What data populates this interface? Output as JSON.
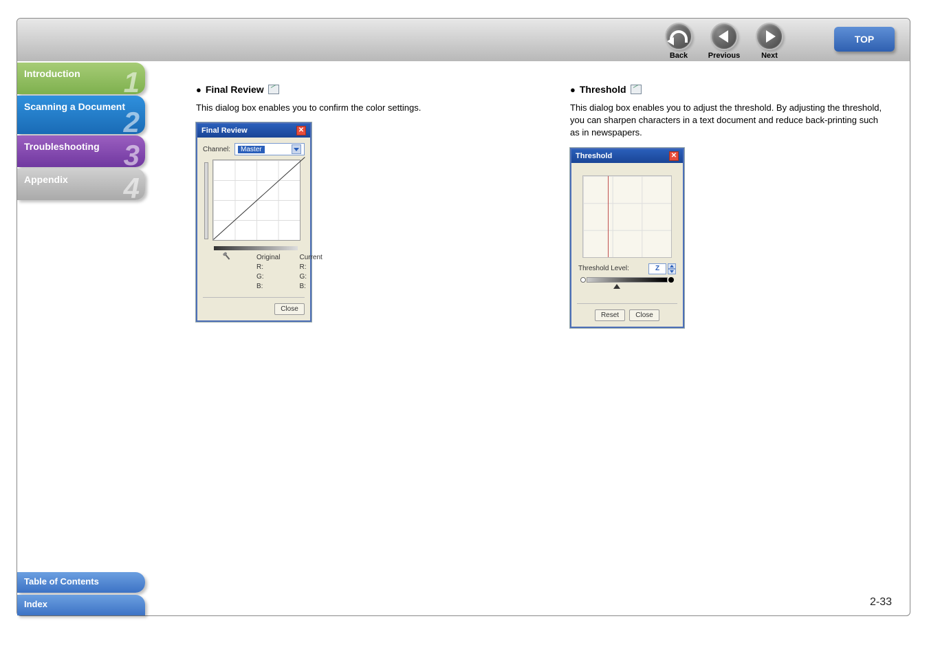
{
  "nav": {
    "back": "Back",
    "previous": "Previous",
    "next": "Next",
    "top": "TOP"
  },
  "sidebar": {
    "items": [
      {
        "label": "Introduction",
        "num": "1"
      },
      {
        "label": "Scanning a Document",
        "num": "2"
      },
      {
        "label": "Troubleshooting",
        "num": "3"
      },
      {
        "label": "Appendix",
        "num": "4"
      }
    ],
    "toc": "Table of Contents",
    "index": "Index"
  },
  "left": {
    "heading": "Final Review",
    "body": "This dialog box enables you to confirm the color settings.",
    "dialog": {
      "title": "Final Review",
      "channel_label": "Channel:",
      "channel_value": "Master",
      "col1_header": "Original",
      "col2_header": "Current",
      "r": "R:",
      "g": "G:",
      "b": "B:",
      "close": "Close"
    }
  },
  "right": {
    "heading": "Threshold",
    "body": "This dialog box enables you to adjust the threshold. By adjusting the threshold, you can sharpen characters in a text document and reduce back-printing such as in newspapers.",
    "dialog": {
      "title": "Threshold",
      "level_label": "Threshold Level:",
      "level_value": "Z",
      "reset": "Reset",
      "close": "Close"
    }
  },
  "page_number": "2-33"
}
